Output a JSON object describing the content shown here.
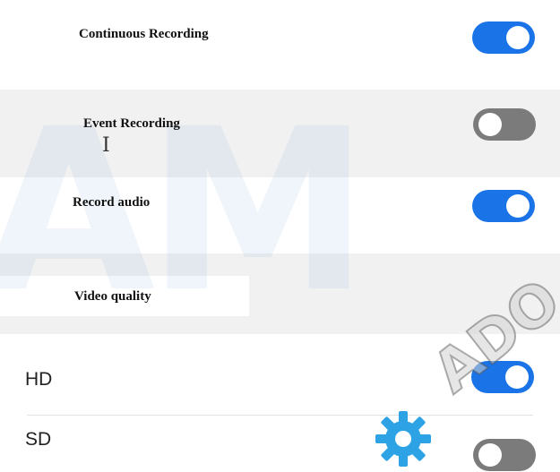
{
  "settings": {
    "continuous_recording": {
      "label": "Continuous Recording",
      "enabled": true
    },
    "event_recording": {
      "label": "Event Recording",
      "enabled": false
    },
    "record_audio": {
      "label": "Record audio",
      "enabled": true
    }
  },
  "video_quality": {
    "heading": "Video quality",
    "options": [
      {
        "label": "HD",
        "enabled": true
      },
      {
        "label": "SD",
        "enabled": false
      }
    ]
  },
  "watermark": {
    "background_letters": "AM",
    "stamp_text": "ADO"
  },
  "colors": {
    "toggle_on": "#1a74e8",
    "toggle_off": "#7b7b7b",
    "gear_icon": "#2da3e6"
  },
  "icons": {
    "text_cursor": "text-cursor-icon",
    "gear": "gear-icon"
  }
}
